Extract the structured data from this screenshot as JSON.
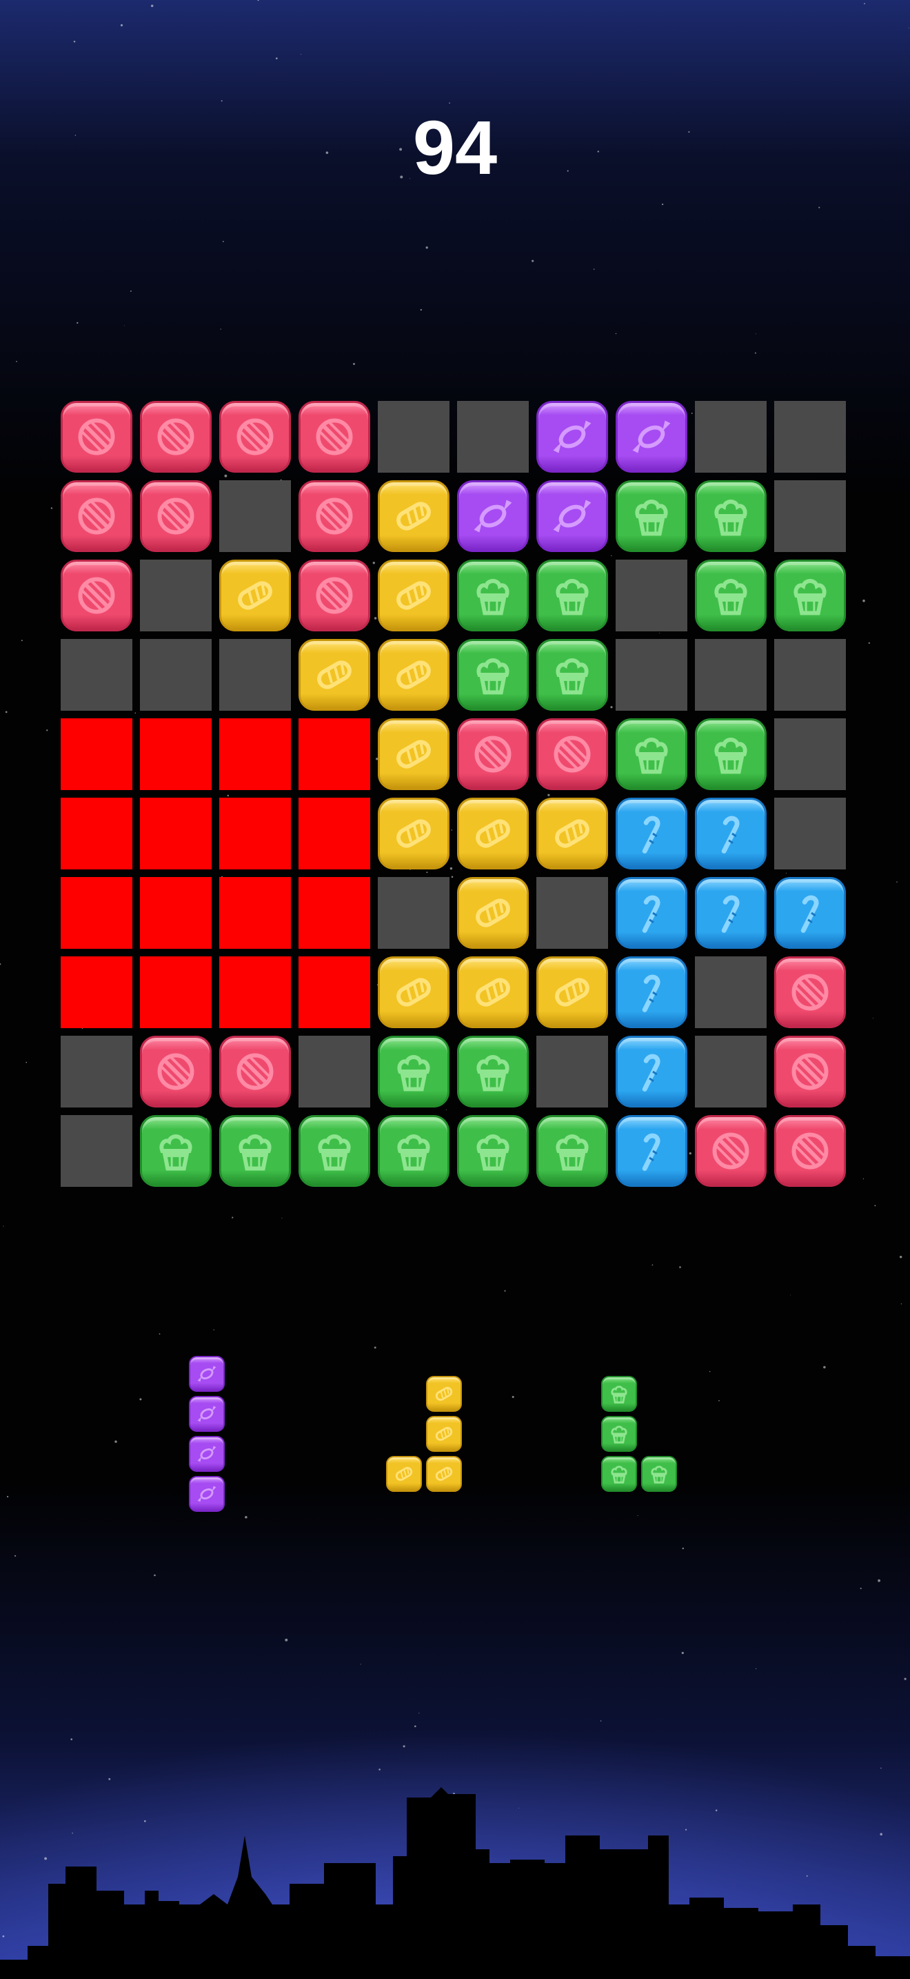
{
  "score": "94",
  "colors": {
    "pink": {
      "base": "#ef4a6e",
      "light": "#ff8aa5",
      "dark": "#c2284c"
    },
    "purple": {
      "base": "#a64cf2",
      "light": "#d59bff",
      "dark": "#7c27c9"
    },
    "yellow": {
      "base": "#f2c324",
      "light": "#ffe277",
      "dark": "#c7960d"
    },
    "green": {
      "base": "#3fbf49",
      "light": "#8ee58f",
      "dark": "#238f2c"
    },
    "blue": {
      "base": "#2da6f0",
      "light": "#8bd6ff",
      "dark": "#1677c5"
    },
    "empty": "#4a4a4a",
    "highlight": "#ff0000"
  },
  "icons": {
    "pink": "ball-candy-icon",
    "purple": "wrapped-candy-icon",
    "yellow": "striped-candy-icon",
    "green": "cupcake-icon",
    "blue": "candy-cane-icon"
  },
  "board": {
    "rows": [
      [
        "pink",
        "pink",
        "pink",
        "pink",
        "empty",
        "empty",
        "purple",
        "purple",
        "empty",
        "empty"
      ],
      [
        "pink",
        "pink",
        "empty",
        "pink",
        "yellow",
        "purple",
        "purple",
        "green",
        "green",
        "empty"
      ],
      [
        "pink",
        "empty",
        "yellow",
        "pink",
        "yellow",
        "green",
        "green",
        "empty",
        "green",
        "green"
      ],
      [
        "empty",
        "empty",
        "empty",
        "yellow",
        "yellow",
        "green",
        "green",
        "empty",
        "empty",
        "empty"
      ],
      [
        "red",
        "red",
        "red",
        "red",
        "yellow",
        "pink",
        "pink",
        "green",
        "green",
        "empty"
      ],
      [
        "red",
        "red",
        "red",
        "red",
        "yellow",
        "yellow",
        "yellow",
        "blue",
        "blue",
        "empty"
      ],
      [
        "red",
        "red",
        "red",
        "red",
        "empty",
        "yellow",
        "empty",
        "blue",
        "blue",
        "blue"
      ],
      [
        "red",
        "red",
        "red",
        "red",
        "yellow",
        "yellow",
        "yellow",
        "blue",
        "empty",
        "pink"
      ],
      [
        "empty",
        "pink",
        "pink",
        "empty",
        "green",
        "green",
        "empty",
        "blue",
        "empty",
        "pink"
      ],
      [
        "empty",
        "green",
        "green",
        "green",
        "green",
        "green",
        "green",
        "blue",
        "pink",
        "pink"
      ]
    ]
  },
  "pieces": [
    {
      "name": "piece-purple-vertical-4",
      "color": "purple",
      "cells": [
        [
          0,
          0
        ],
        [
          0,
          1
        ],
        [
          0,
          2
        ],
        [
          0,
          3
        ]
      ]
    },
    {
      "name": "piece-yellow-j",
      "color": "yellow",
      "cells": [
        [
          1,
          0
        ],
        [
          1,
          1
        ],
        [
          0,
          2
        ],
        [
          1,
          2
        ]
      ]
    },
    {
      "name": "piece-green-l",
      "color": "green",
      "cells": [
        [
          0,
          0
        ],
        [
          0,
          1
        ],
        [
          0,
          2
        ],
        [
          1,
          2
        ]
      ]
    }
  ]
}
